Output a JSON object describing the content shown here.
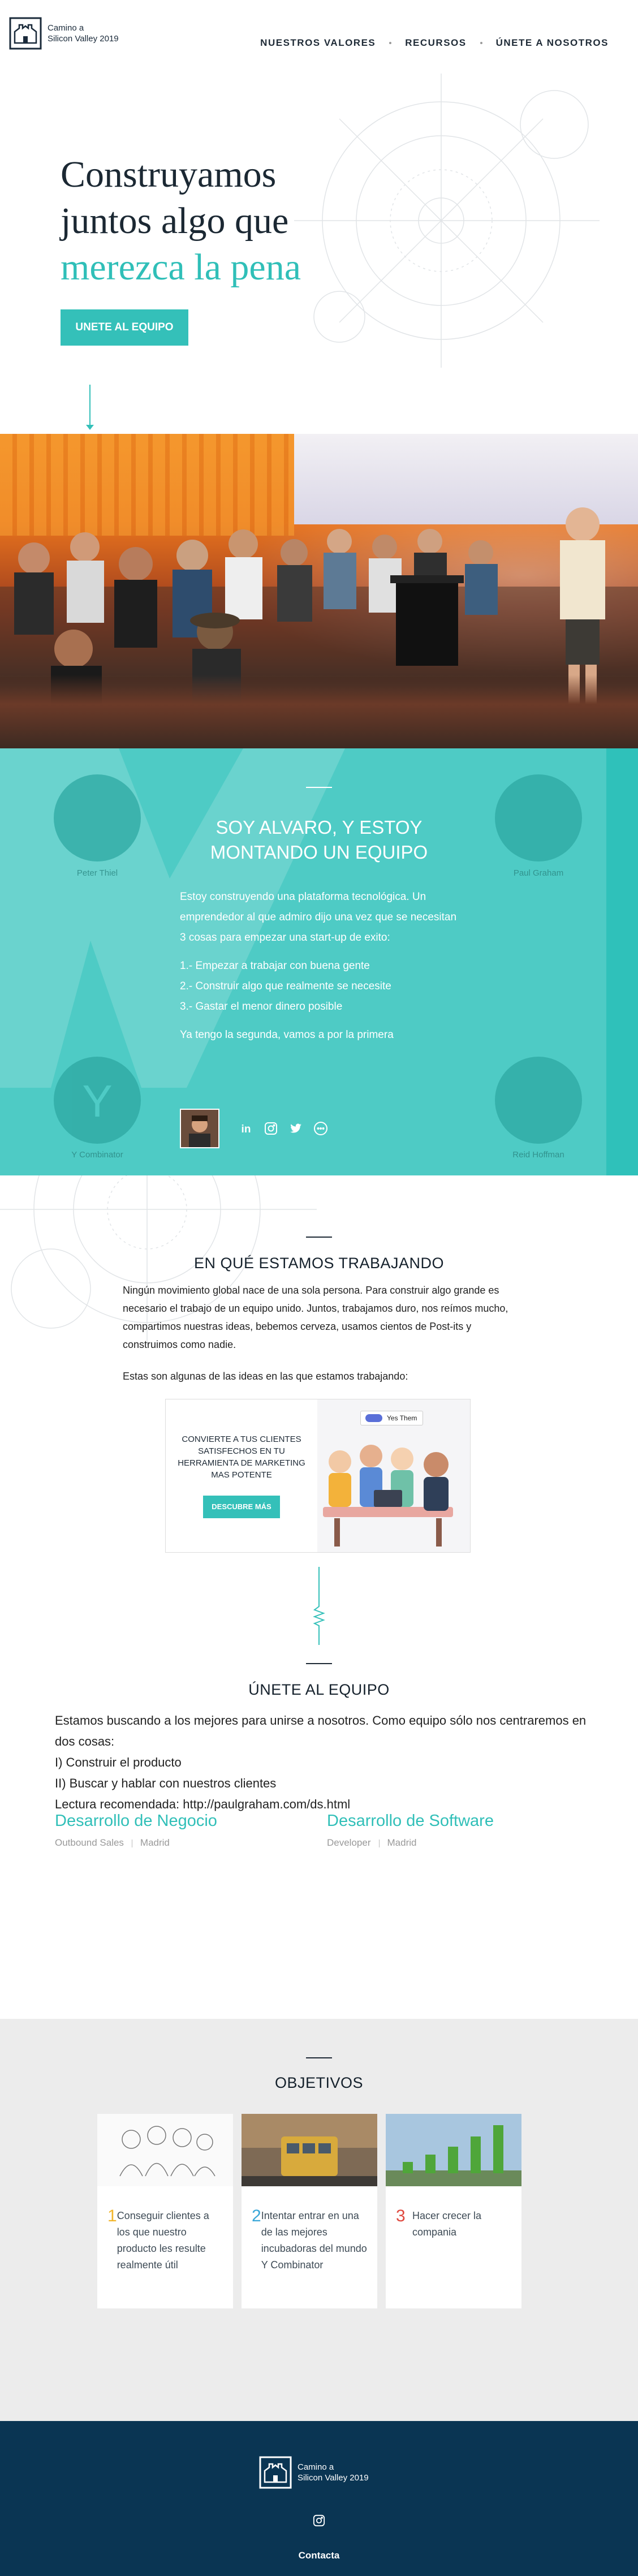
{
  "brand": {
    "line1": "Camino a",
    "line2": "Silicon Valley 2019"
  },
  "nav": [
    "NUESTROS VALORES",
    "RECURSOS",
    "ÚNETE A NOSOTROS"
  ],
  "hero": {
    "title_line1": "Construyamos",
    "title_line2": "juntos algo que",
    "title_accent": "merezca la pena",
    "cta": "UNETE AL EQUIPO"
  },
  "alvaro": {
    "title_line1": "SOY ALVARO, Y ESTOY",
    "title_line2": "MONTANDO UN EQUIPO",
    "intro": "Estoy construyendo una plataforma tecnológica. Un emprendedor al que admiro dijo una vez que se necesitan 3 cosas para empezar una start-up de exito:",
    "list": [
      "1.- Empezar a trabajar con buena gente",
      "2.- Construir algo que realmente se necesite",
      "3.- Gastar el menor dinero posible"
    ],
    "closing": "Ya tengo la segunda, vamos a por la primera",
    "social_icons": [
      "linkedin-icon",
      "instagram-icon",
      "twitter-icon",
      "medium-icon"
    ],
    "background_people": [
      "Peter Thiel",
      "Paul Graham",
      "Y Combinator",
      "Reid Hoffman"
    ]
  },
  "working": {
    "title": "EN QUÉ ESTAMOS TRABAJANDO",
    "paragraph": "Ningún movimiento global nace de una sola persona. Para construir algo grande es necesario el trabajo de un equipo unido. Juntos, trabajamos duro, nos reímos mucho, compartimos nuestras ideas, bebemos cerveza, usamos cientos de Post-its y construimos como nadie.",
    "ideas_intro": "Estas son algunas de las ideas en las que estamos trabajando:",
    "promo_text": "CONVIERTE A TUS CLIENTES SATISFECHOS EN TU HERRAMIENTA DE MARKETING MAS POTENTE",
    "promo_button": "DESCUBRE MÁS",
    "promo_badge": "Yes Them"
  },
  "join": {
    "title": "ÚNETE AL EQUIPO",
    "lines": [
      "Estamos buscando a los mejores para unirse a nosotros. Como equipo sólo nos centraremos en dos cosas:",
      "I) Construir el producto",
      "II) Buscar y hablar con nuestros clientes",
      "Lectura recomendada: http://paulgraham.com/ds.html"
    ],
    "jobs": [
      {
        "title": "Desarrollo de Negocio",
        "area": "Outbound Sales",
        "location": "Madrid"
      },
      {
        "title": "Desarrollo de Software",
        "area": "Developer",
        "location": "Madrid"
      }
    ]
  },
  "objectives": {
    "title": "OBJETIVOS",
    "items": [
      {
        "num": "1",
        "text": "Conseguir clientes a los que nuestro producto les resulte realmente útil",
        "color": "#f2b52a"
      },
      {
        "num": "2",
        "text": "Intentar entrar en una de las mejores incubadoras del mundo Y Combinator",
        "color": "#3aa7d8"
      },
      {
        "num": "3",
        "text": "Hacer crecer la compania",
        "color": "#e0493f"
      }
    ]
  },
  "footer": {
    "contact": "Contacta"
  },
  "colors": {
    "teal": "#34c0b9",
    "navy": "#0a3553",
    "panel": "#4ecbc5"
  }
}
